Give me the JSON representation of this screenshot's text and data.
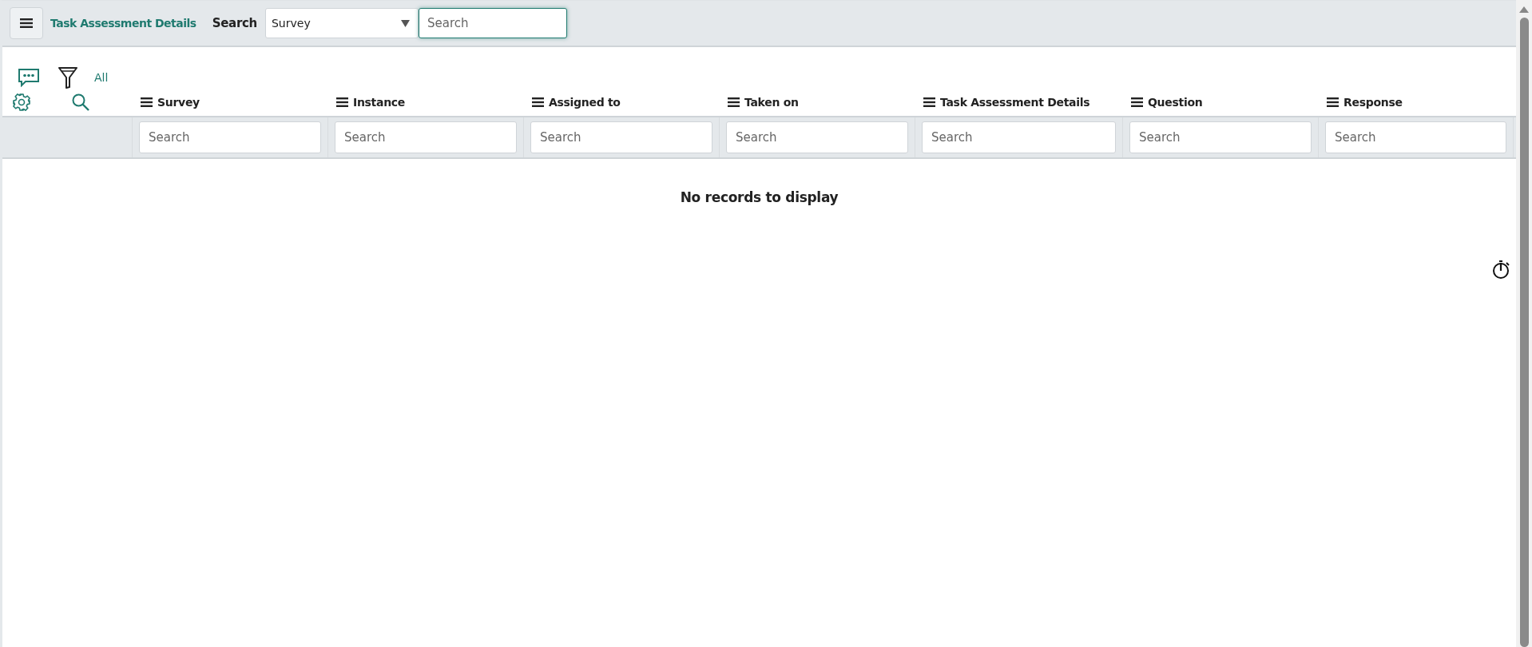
{
  "header": {
    "title": "Task Assessment Details",
    "search_label": "Search",
    "search_field": {
      "value": "Survey"
    },
    "search_input": {
      "placeholder": "Search"
    }
  },
  "toolbar": {
    "filter_label": "All"
  },
  "table": {
    "columns": [
      {
        "label": "Survey",
        "placeholder": "Search"
      },
      {
        "label": "Instance",
        "placeholder": "Search"
      },
      {
        "label": "Assigned to",
        "placeholder": "Search"
      },
      {
        "label": "Taken on",
        "placeholder": "Search"
      },
      {
        "label": "Task Assessment Details",
        "placeholder": "Search"
      },
      {
        "label": "Question",
        "placeholder": "Search"
      },
      {
        "label": "Response",
        "placeholder": "Search"
      }
    ],
    "empty_message": "No records to display"
  }
}
